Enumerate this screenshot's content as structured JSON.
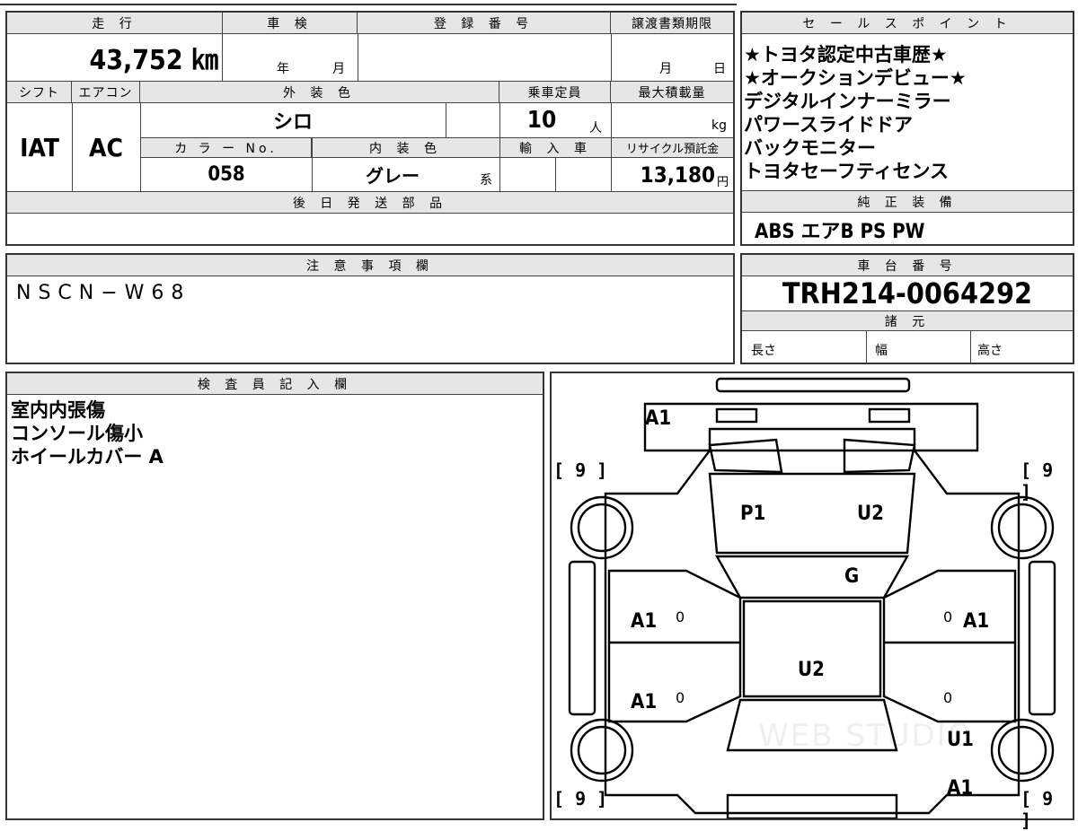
{
  "main_table": {
    "mileage_header": "走 行",
    "mileage_value": "43,752 ㎞",
    "shaken_header": "車 検",
    "shaken_year": "年",
    "shaken_month": "月",
    "registration_header": "登 録 番 号",
    "transfer_header": "譲渡書類期限",
    "transfer_month": "月",
    "transfer_day": "日",
    "shift_header": "シフト",
    "shift_value": "IAT",
    "aircon_header": "エアコン",
    "aircon_value": "AC",
    "exterior_header": "外 装 色",
    "exterior_value": "シロ",
    "capacity_header": "乗車定員",
    "capacity_value": "10",
    "capacity_unit": "人",
    "maxload_header": "最大積載量",
    "maxload_unit": "kg",
    "color_no_header": "カ ラ ー No.",
    "color_no_value": "058",
    "interior_header": "内 装 色",
    "interior_value": "グレー",
    "interior_suffix": "系",
    "import_header": "輸 入 車",
    "recycle_header": "リサイクル預託金",
    "recycle_value": "13,180",
    "recycle_unit": "円",
    "later_parts_header": "後 日 発 送 部 品"
  },
  "sales_points": {
    "header": "セ ー ル ス ポ イ ン ト",
    "items": [
      "★トヨタ認定中古車歴★",
      "★オークションデビュー★",
      "デジタルインナーミラー",
      "パワースライドドア",
      "バックモニター",
      "トヨタセーフティセンス"
    ]
  },
  "equipment": {
    "header": "純 正 装 備",
    "value": "ABS エアB PS PW"
  },
  "notes": {
    "header": "注 意 事 項 欄",
    "value": "NSCN−W68"
  },
  "chassis": {
    "header": "車 台 番 号",
    "value": "TRH214-0064292",
    "specs_header": "諸 元",
    "length_label": "長さ",
    "width_label": "幅",
    "height_label": "高さ"
  },
  "inspector": {
    "header": "検 査 員 記 入 欄",
    "lines": [
      "室内内張傷",
      "コンソール傷小",
      "ホイールカバー A"
    ]
  },
  "diagram": {
    "tread_labels": [
      "[ 9 ]",
      "[ 9 ]",
      "[ 9 ]",
      "[ 9 ]"
    ],
    "marks": {
      "front_bumper": "A1",
      "hood_left": "P1",
      "hood_right": "U2",
      "windshield": "G",
      "roof": "U2",
      "left_front_door": "A1",
      "right_front_door": "A1",
      "left_rear_door": "A1",
      "right_rear_quarter": "U1",
      "rear_right": "A1"
    },
    "door_zero": "0",
    "watermark": "WEB STUDIO"
  }
}
